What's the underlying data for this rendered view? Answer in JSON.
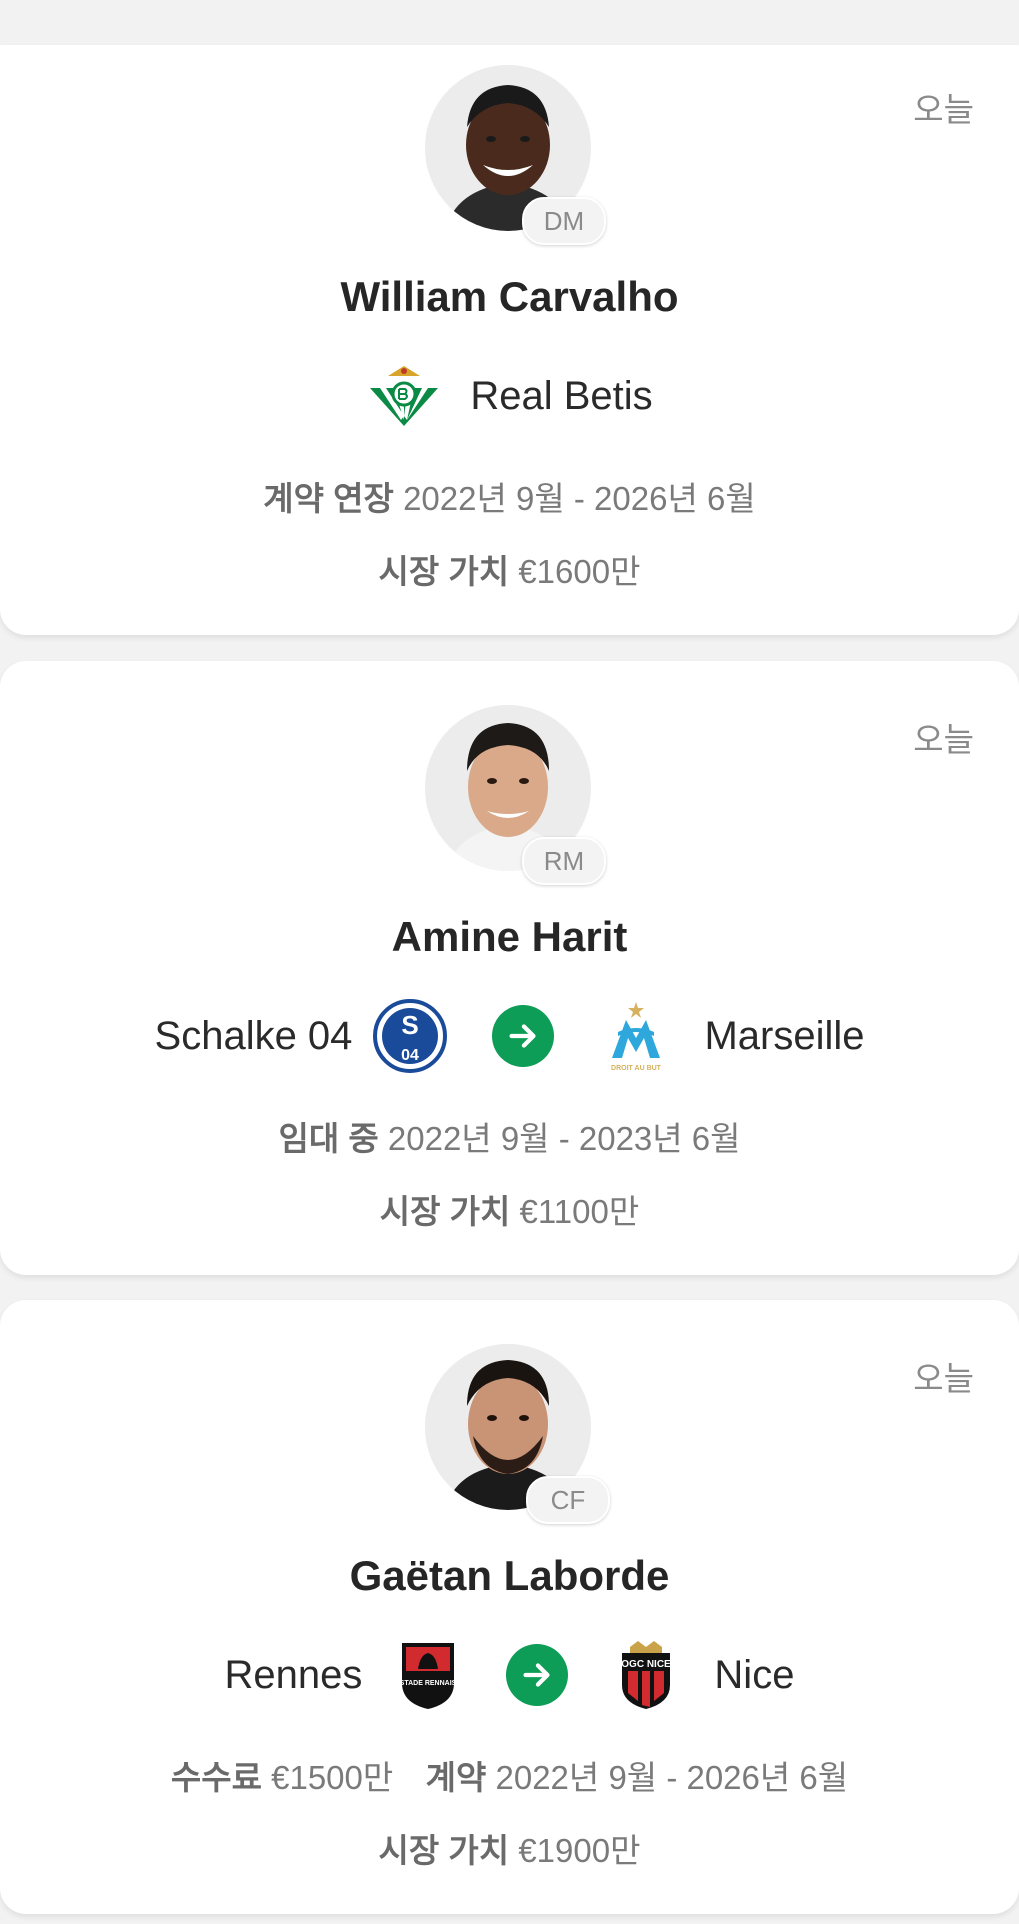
{
  "colors": {
    "accent_green": "#0e9d57",
    "muted": "#8a8a8a",
    "card_bg": "#ffffff",
    "page_bg": "#f2f2f2"
  },
  "transfers": [
    {
      "date": "오늘",
      "player": "William Carvalho",
      "position": "DM",
      "club": "Real Betis",
      "contract_label": "계약 연장",
      "contract_value": "2022년 9월 - 2026년 6월",
      "value_label": "시장 가치",
      "value": "€1600만"
    },
    {
      "date": "오늘",
      "player": "Amine Harit",
      "position": "RM",
      "from_club": "Schalke 04",
      "to_club": "Marseille",
      "loan_label": "임대 중",
      "loan_value": "2022년 9월 - 2023년 6월",
      "value_label": "시장 가치",
      "value": "€1100만"
    },
    {
      "date": "오늘",
      "player": "Gaëtan Laborde",
      "position": "CF",
      "from_club": "Rennes",
      "to_club": "Nice",
      "fee_label": "수수료",
      "fee_value": "€1500만",
      "contract_label": "계약",
      "contract_value": "2022년 9월 - 2026년 6월",
      "value_label": "시장 가치",
      "value": "€1900만"
    }
  ],
  "crest_text": {
    "schalke": "S04",
    "marseille_motto": "DROIT AU BUT",
    "rennes": "STADE RENNAIS",
    "nice": "OGC NICE"
  }
}
